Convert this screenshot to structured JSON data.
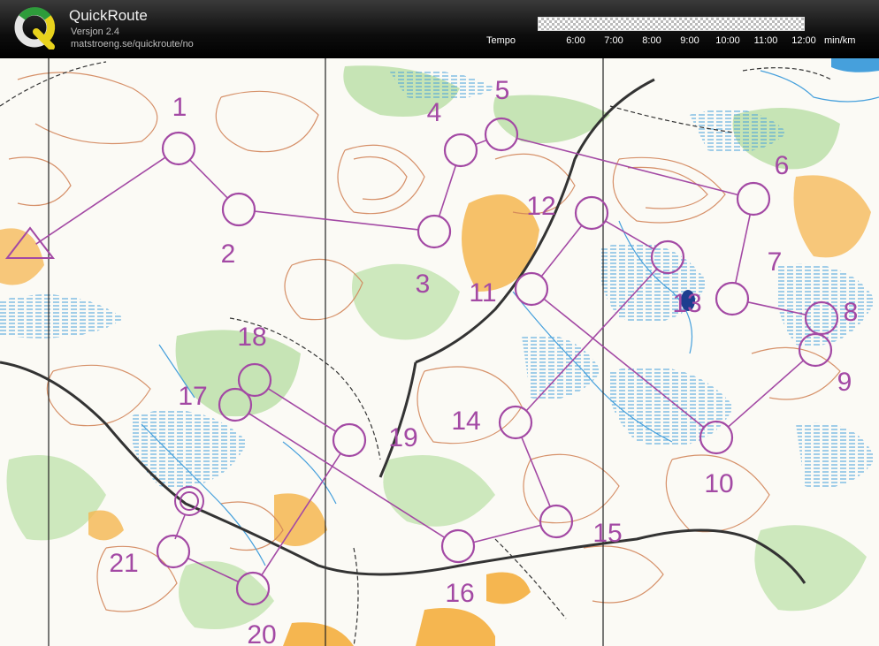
{
  "app": {
    "title": "QuickRoute",
    "version": "Versjon 2.4",
    "url": "matstroeng.se/quickroute/no",
    "logo_letter": "Q"
  },
  "tempo": {
    "label": "Tempo",
    "ticks": [
      "6:00",
      "7:00",
      "8:00",
      "9:00",
      "10:00",
      "11:00",
      "12:00"
    ],
    "unit": "min/km"
  },
  "map": {
    "controls": [
      {
        "number": "1"
      },
      {
        "number": "2"
      },
      {
        "number": "3"
      },
      {
        "number": "4"
      },
      {
        "number": "5"
      },
      {
        "number": "6"
      },
      {
        "number": "7"
      },
      {
        "number": "8"
      },
      {
        "number": "9"
      },
      {
        "number": "10"
      },
      {
        "number": "11"
      },
      {
        "number": "12"
      },
      {
        "number": "13"
      },
      {
        "number": "14"
      },
      {
        "number": "15"
      },
      {
        "number": "16"
      },
      {
        "number": "17"
      },
      {
        "number": "18"
      },
      {
        "number": "19"
      },
      {
        "number": "20"
      },
      {
        "number": "21"
      }
    ]
  },
  "colors": {
    "course": "#a349a4",
    "contour": "#d2855a",
    "water": "#46a0dc",
    "forest_green": "#b9dfa5",
    "open_yellow": "#f5b650",
    "road": "#333333"
  }
}
